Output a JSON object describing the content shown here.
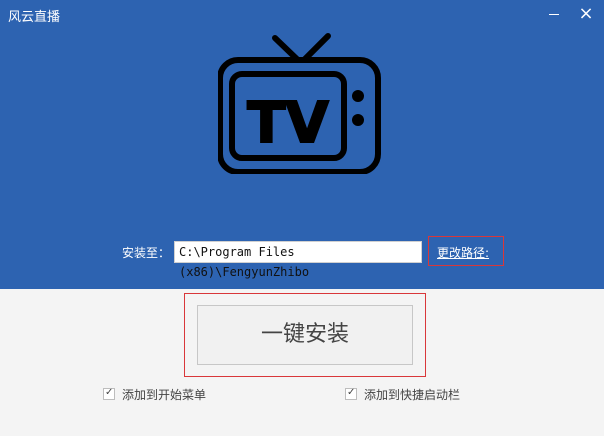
{
  "window": {
    "title": "风云直播",
    "minimize_icon": "minimize-icon",
    "close_icon": "close-icon",
    "close_glyph": "×"
  },
  "logo": {
    "icon": "tv-icon",
    "text": "TV"
  },
  "install_path": {
    "label": "安装至：",
    "value": "C:\\Program Files (x86)\\FengyunZhibo",
    "change_link": "更改路径:"
  },
  "install_button": {
    "label": "一键安装"
  },
  "options": [
    {
      "label": "添加到开始菜单",
      "checked": true
    },
    {
      "label": "添加到快捷启动栏",
      "checked": true
    }
  ],
  "colors": {
    "header_bg": "#2d63b1",
    "highlight_border": "#d9373a"
  }
}
